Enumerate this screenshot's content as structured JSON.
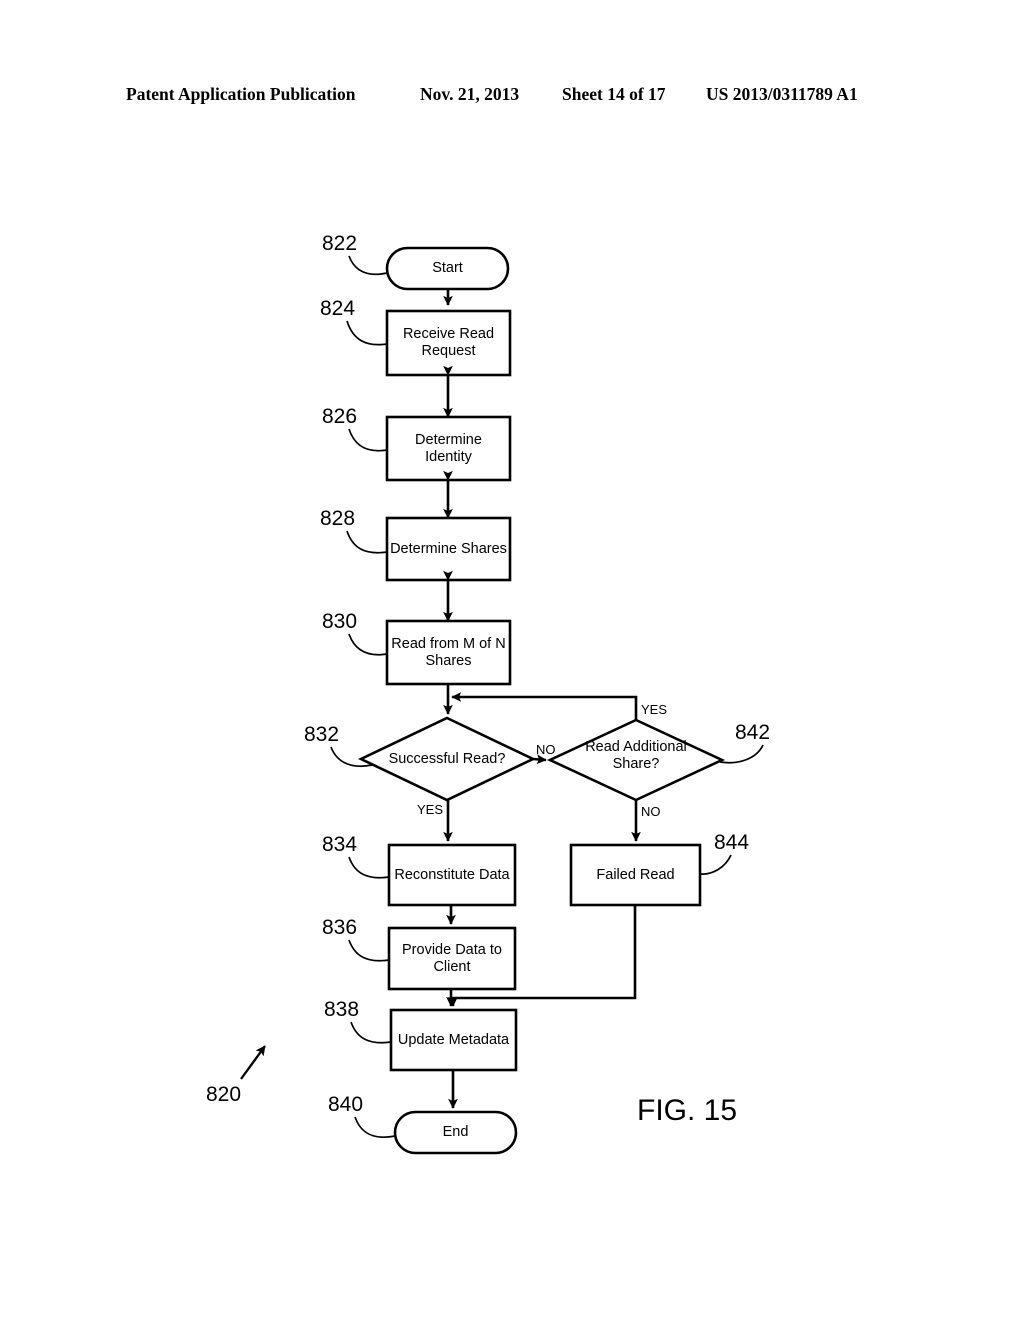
{
  "header": {
    "publication": "Patent Application Publication",
    "date": "Nov. 21, 2013",
    "sheet": "Sheet 14 of 17",
    "document_number": "US 2013/0311789 A1"
  },
  "figure": {
    "caption": "FIG. 15",
    "overall_ref": "820",
    "nodes": [
      {
        "ref": "822",
        "label": "Start",
        "shape": "terminator"
      },
      {
        "ref": "824",
        "label": "Receive Read\nRequest",
        "shape": "process"
      },
      {
        "ref": "826",
        "label": "Determine\nIdentity",
        "shape": "process"
      },
      {
        "ref": "828",
        "label": "Determine Shares",
        "shape": "process"
      },
      {
        "ref": "830",
        "label": "Read from M of N\nShares",
        "shape": "process"
      },
      {
        "ref": "832",
        "label": "Successful Read?",
        "shape": "decision"
      },
      {
        "ref": "842",
        "label": "Read Additional\nShare?",
        "shape": "decision"
      },
      {
        "ref": "834",
        "label": "Reconstitute Data",
        "shape": "process"
      },
      {
        "ref": "844",
        "label": "Failed Read",
        "shape": "process"
      },
      {
        "ref": "836",
        "label": "Provide Data to\nClient",
        "shape": "process"
      },
      {
        "ref": "838",
        "label": "Update Metadata",
        "shape": "process"
      },
      {
        "ref": "840",
        "label": "End",
        "shape": "terminator"
      }
    ],
    "edge_labels": {
      "successful_read_no": "NO",
      "successful_read_yes": "YES",
      "read_additional_yes": "YES",
      "read_additional_no": "NO"
    },
    "colors": {
      "stroke": "#000000",
      "fill": "#ffffff",
      "background": "#ffffff"
    }
  }
}
